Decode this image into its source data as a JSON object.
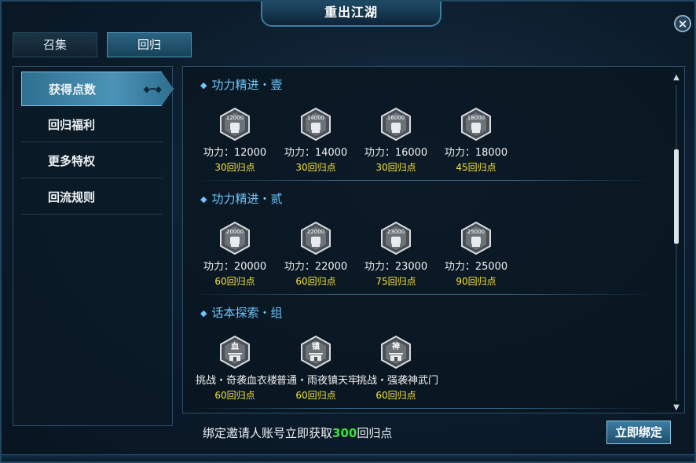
{
  "window": {
    "title": "重出江湖",
    "close_label": "✕"
  },
  "tabs": [
    {
      "label": "召集",
      "active": false
    },
    {
      "label": "回归",
      "active": true
    }
  ],
  "sidebar": {
    "items": [
      {
        "label": "获得点数",
        "active": true
      },
      {
        "label": "回归福利",
        "active": false
      },
      {
        "label": "更多特权",
        "active": false
      },
      {
        "label": "回流规则",
        "active": false
      }
    ]
  },
  "sections": [
    {
      "title": "功力精进・壹",
      "items": [
        {
          "icon": "fist-badge-icon",
          "badge": "12000",
          "label": "功力：12000",
          "points": "30回归点"
        },
        {
          "icon": "fist-badge-icon",
          "badge": "14000",
          "label": "功力：14000",
          "points": "30回归点"
        },
        {
          "icon": "fist-badge-icon",
          "badge": "16000",
          "label": "功力：16000",
          "points": "30回归点"
        },
        {
          "icon": "fist-badge-icon",
          "badge": "18000",
          "label": "功力：18000",
          "points": "45回归点"
        }
      ]
    },
    {
      "title": "功力精进・贰",
      "items": [
        {
          "icon": "fist-badge-icon",
          "badge": "20000",
          "label": "功力：20000",
          "points": "60回归点"
        },
        {
          "icon": "fist-badge-icon",
          "badge": "22000",
          "label": "功力：22000",
          "points": "60回归点"
        },
        {
          "icon": "fist-badge-icon",
          "badge": "23000",
          "label": "功力：23000",
          "points": "75回归点"
        },
        {
          "icon": "fist-badge-icon",
          "badge": "25000",
          "label": "功力：25000",
          "points": "90回归点"
        }
      ]
    },
    {
      "title": "话本探索・组",
      "items": [
        {
          "icon": "gate-badge-icon",
          "badge": "血",
          "label": "挑战・奇袭血衣楼",
          "points": "60回归点"
        },
        {
          "icon": "gate-badge-icon",
          "badge": "镇",
          "label": "普通・雨夜镇天牢",
          "points": "60回归点"
        },
        {
          "icon": "gate-badge-icon",
          "badge": "神",
          "label": "挑战・强袭神武门",
          "points": "60回归点"
        }
      ]
    }
  ],
  "footer": {
    "text_prefix": "绑定邀请人账号立即获取",
    "highlight_number": "300",
    "text_suffix": "回归点",
    "bind_button_label": "立即绑定"
  },
  "scrollbar": {
    "position_fraction": 0.25
  },
  "colors": {
    "section_title": "#6ec6ff",
    "points": "#f5e23c",
    "highlight": "#37e33b"
  }
}
